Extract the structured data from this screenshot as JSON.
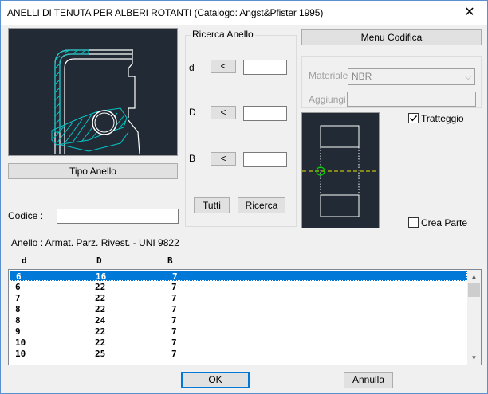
{
  "window": {
    "title": "ANELLI DI TENUTA PER ALBERI ROTANTI (Catalogo: Angst&Pfister 1995)",
    "close": "✕"
  },
  "left": {
    "tipo_anello_button": "Tipo Anello",
    "codice_label": "Codice :",
    "codice_value": ""
  },
  "ricerca": {
    "title": "Ricerca Anello",
    "d_label": "d",
    "D_label": "D",
    "B_label": "B",
    "lt_button": "<",
    "tutti_button": "Tutti",
    "ricerca_button": "Ricerca"
  },
  "codifica": {
    "menu_button": "Menu Codifica",
    "materiale_label": "Materiale",
    "materiale_value": "NBR",
    "aggiungi_label": "Aggiungi",
    "aggiungi_value": ""
  },
  "options": {
    "tratteggio_label": "Tratteggio",
    "tratteggio_checked": true,
    "crea_parte_label": "Crea Parte",
    "crea_parte_checked": false
  },
  "anello_desc": "Anello : Armat. Parz. Rivest.  - UNI 9822",
  "table": {
    "columns": [
      "d",
      "D",
      "B"
    ],
    "rows": [
      [
        "6",
        "16",
        "7"
      ],
      [
        "6",
        "22",
        "7"
      ],
      [
        "7",
        "22",
        "7"
      ],
      [
        "8",
        "22",
        "7"
      ],
      [
        "8",
        "24",
        "7"
      ],
      [
        "9",
        "22",
        "7"
      ],
      [
        "10",
        "22",
        "7"
      ],
      [
        "10",
        "25",
        "7"
      ]
    ],
    "selected_index": 0
  },
  "footer": {
    "ok_button": "OK",
    "annulla_button": "Annulla"
  },
  "colors": {
    "accent": "#0078d7",
    "preview_bg": "#222b35",
    "cyan": "#00c8c8",
    "centerline": "#e6e600",
    "green_circle": "#00d000"
  }
}
